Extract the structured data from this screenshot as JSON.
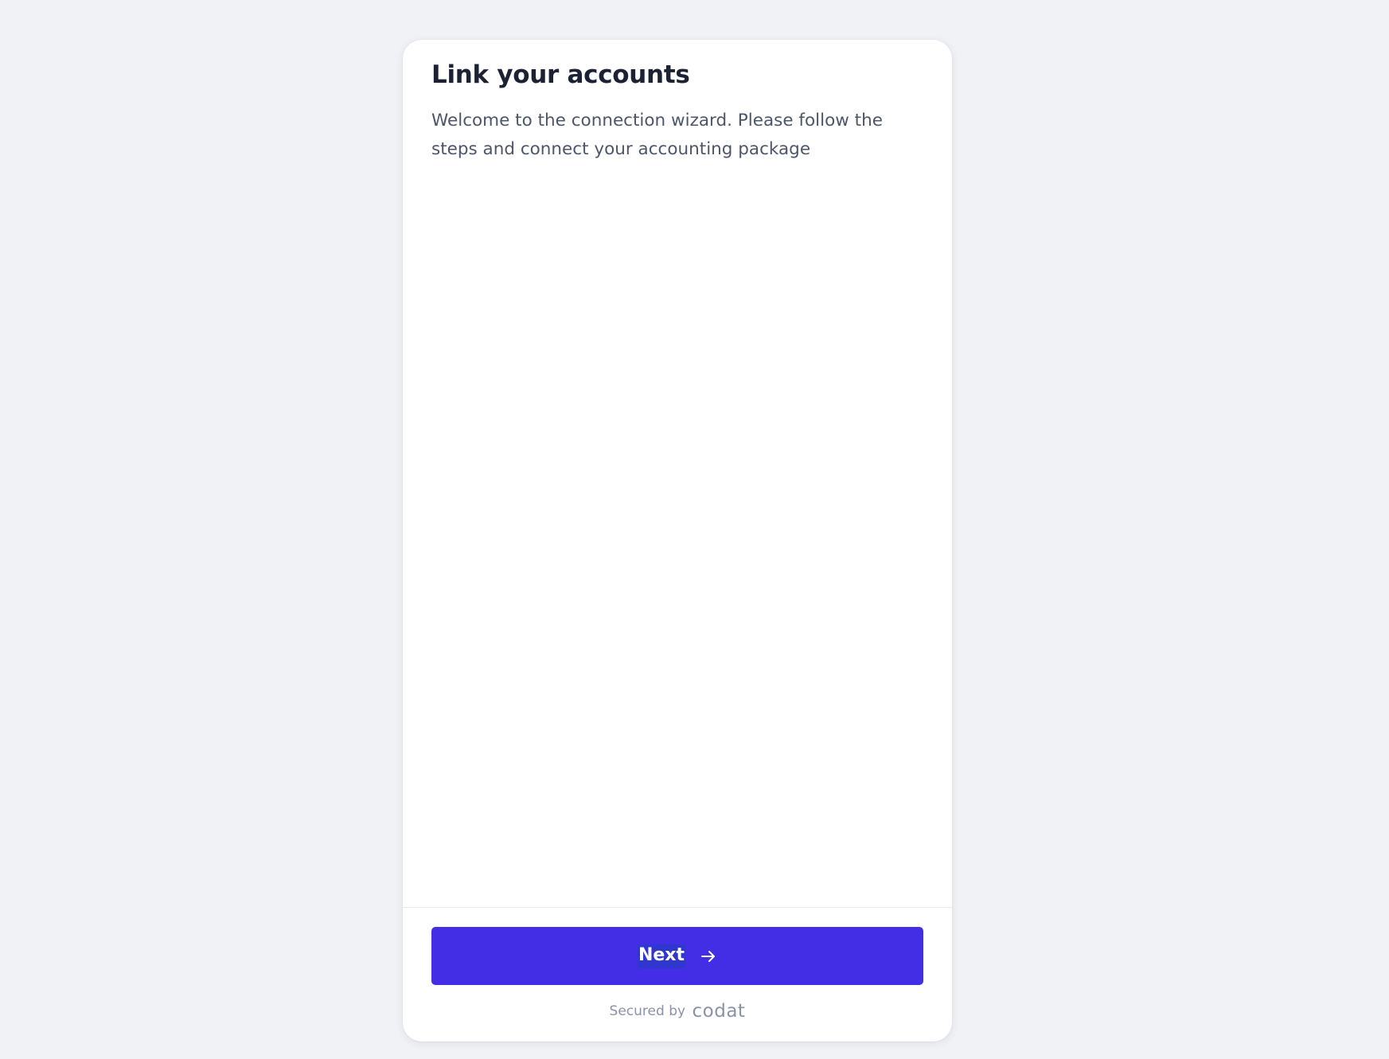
{
  "card": {
    "title": "Link your accounts",
    "subtitle": "Welcome to the connection wizard. Please follow the steps and connect your accounting package"
  },
  "actions": {
    "next_label": "Next",
    "next_icon": "arrow-right-icon",
    "accent_color": "#432ee5"
  },
  "footer": {
    "secured_text": "Secured by",
    "brand_name": "codat"
  }
}
